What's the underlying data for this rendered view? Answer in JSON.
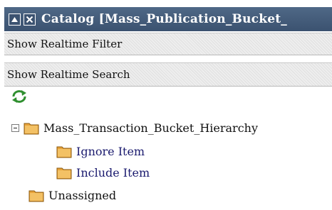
{
  "titlebar": {
    "title": "Catalog [Mass_Publication_Bucket_",
    "buttons": [
      "minimize-icon",
      "close-icon"
    ]
  },
  "bars": {
    "filter_label": "Show Realtime Filter",
    "search_label": "Show Realtime Search"
  },
  "tree": {
    "refresh_icon": "refresh-icon",
    "root": {
      "label": "Mass_Transaction_Bucket_Hierarchy",
      "expanded": true,
      "children": [
        "Ignore Item",
        "Include Item"
      ]
    },
    "unassigned": "Unassigned"
  },
  "colors": {
    "titlebar": "#3b5270",
    "folder": "#e8a33a",
    "link": "#1a1a6e",
    "refresh": "#2f8f2f"
  }
}
